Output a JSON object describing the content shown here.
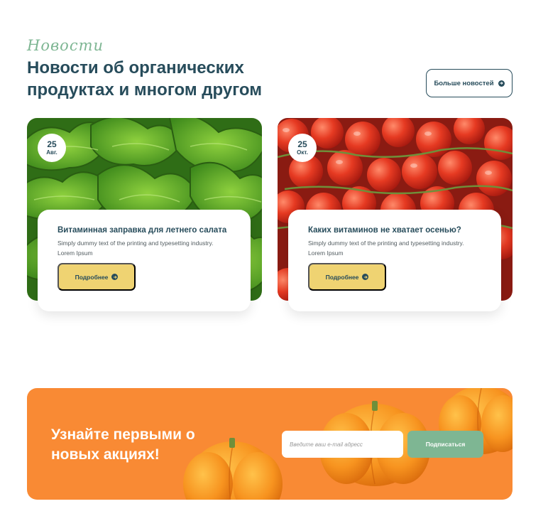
{
  "header": {
    "eyebrow": "Новости",
    "title": "Новости об органических продуктах и многом другом",
    "more_button": "Больше новостей"
  },
  "cards": [
    {
      "date_day": "25",
      "date_month": "Авг.",
      "title": "Витаминная заправка для летнего салата",
      "text": "Simply dummy text of the printing and typesetting industry. Lorem Ipsum",
      "button": "Подробнее"
    },
    {
      "date_day": "25",
      "date_month": "Окт.",
      "title": "Каких витаминов не хватает осенью?",
      "text": "Simply dummy text of the printing and typesetting industry. Lorem Ipsum",
      "button": "Подробнее"
    }
  ],
  "subscribe": {
    "title": "Узнайте первыми о новых акциях!",
    "email_placeholder": "Введите ваш e-mail адресс",
    "button": "Подписаться"
  },
  "icons": {
    "arrow": "arrow-right-circle-icon"
  },
  "colors": {
    "primary": "#274c5b",
    "accent_green": "#7eb693",
    "accent_yellow": "#efd372",
    "promo_orange": "#f98a34"
  }
}
